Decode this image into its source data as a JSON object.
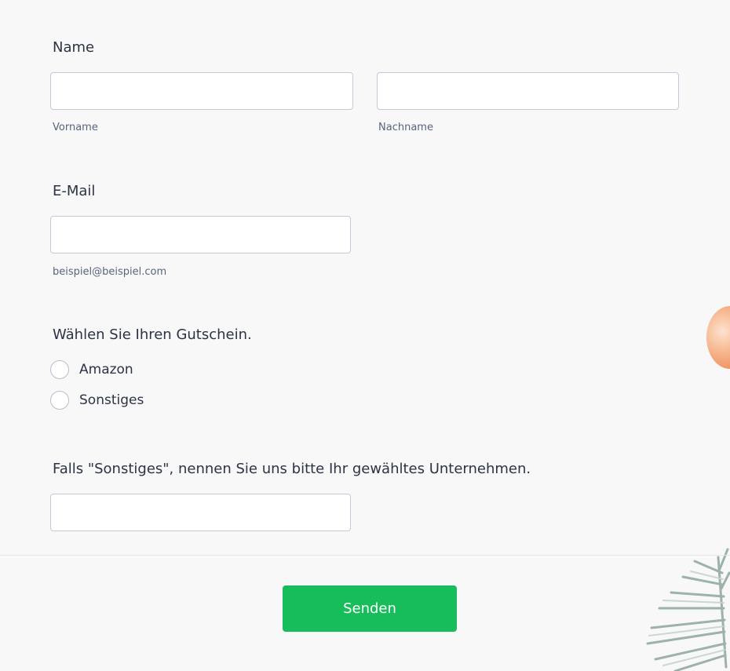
{
  "form": {
    "name": {
      "label": "Name",
      "first_name": {
        "value": "",
        "sublabel": "Vorname"
      },
      "last_name": {
        "value": "",
        "sublabel": "Nachname"
      }
    },
    "email": {
      "label": "E-Mail",
      "value": "",
      "sublabel": "beispiel@beispiel.com"
    },
    "voucher": {
      "label": "Wählen Sie Ihren Gutschein.",
      "options": [
        {
          "label": "Amazon",
          "selected": false
        },
        {
          "label": "Sonstiges",
          "selected": false
        }
      ]
    },
    "other_company": {
      "label": "Falls \"Sonstiges\", nennen Sie uns bitte Ihr gewähltes Unternehmen.",
      "value": ""
    },
    "submit_label": "Senden"
  },
  "colors": {
    "background": "#f8f8f9",
    "text": "#2c3345",
    "submit": "#18bd5b",
    "input_border": "#c3cad8"
  },
  "icons": {
    "radio": "radio-empty-circle",
    "decor_ornament": "orange-ornament",
    "decor_branch": "fir-branch"
  }
}
